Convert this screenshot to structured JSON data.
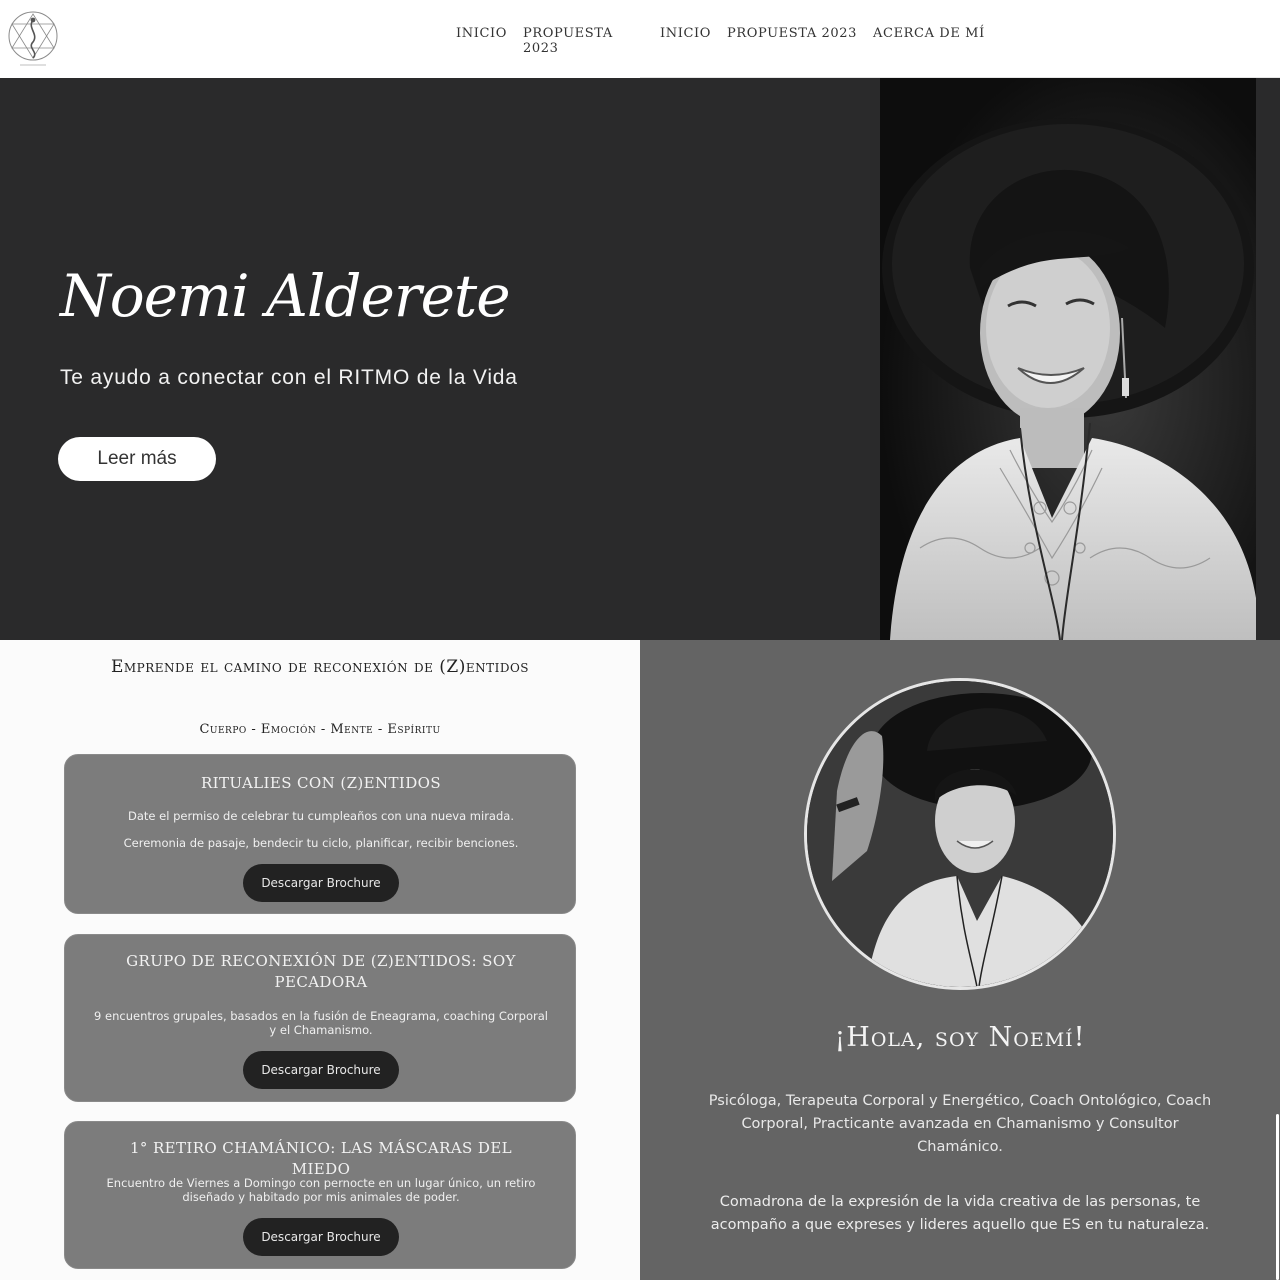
{
  "header": {
    "nav_left": [
      "INICIO",
      "PROPUESTA 2023"
    ],
    "nav_right": [
      "INICIO",
      "PROPUESTA 2023",
      "ACERCA DE MÍ"
    ]
  },
  "hero": {
    "title": "Noemi Alderete",
    "subtitle": "Te ayudo a conectar con el RITMO de la Vida",
    "button": "Leer más"
  },
  "services": {
    "title": "Emprende el camino de reconexión de (Z)entidos",
    "subtitle": "Cuerpo - Emoción - Mente - Espíritu",
    "cards": [
      {
        "title": "RITUALIES CON (Z)ENTIDOS",
        "lines": [
          "Date el permiso de celebrar tu cumpleaños con una nueva mirada.",
          "Ceremonia de pasaje, bendecir tu ciclo, planificar, recibir benciones."
        ],
        "button": "Descargar Brochure"
      },
      {
        "title": "GRUPO DE RECONEXIÓN DE (Z)ENTIDOS: SOY PECADORA",
        "lines": [
          "9 encuentros grupales, basados en la fusión de Eneagrama, coaching Corporal y el Chamanismo."
        ],
        "button": "Descargar Brochure"
      },
      {
        "title": "1° RETIRO CHAMÁNICO: LAS MÁSCARAS DEL MIEDO",
        "lines": [
          "Encuentro de Viernes a Domingo con pernocte en un lugar único, un retiro diseñado y habitado por mis animales de poder."
        ],
        "button": "Descargar Brochure"
      }
    ]
  },
  "about": {
    "title": "¡Hola, soy Noemí!",
    "p1": "Psicóloga, Terapeuta Corporal y Energético, Coach Ontológico, Coach Corporal, Practicante avanzada en Chamanismo y Consultor Chamánico.",
    "p2": "Comadrona de la expresión de la vida creativa de las personas, te acompaño a que expreses y lideres aquello que ES en tu naturaleza."
  },
  "colors": {
    "hero_bg": "#2a2a2b",
    "card_bg": "#7c7c7c",
    "about_bg": "#646464",
    "button_dark": "#222222"
  }
}
